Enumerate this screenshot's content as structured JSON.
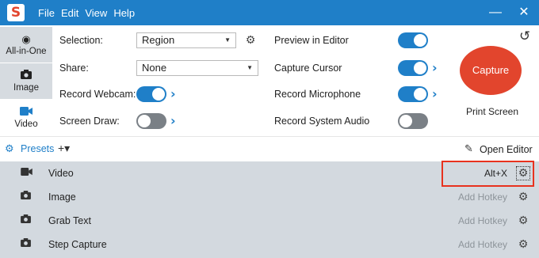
{
  "app": {
    "logo_letter": "S"
  },
  "menu": {
    "items": [
      "File",
      "Edit",
      "View",
      "Help"
    ]
  },
  "window": {
    "minimize": "—",
    "close": "✕"
  },
  "modes": [
    {
      "label": "All-in-One",
      "icon": "all-in-one-icon",
      "glyph": "◉",
      "active": false
    },
    {
      "label": "Image",
      "icon": "camera-icon",
      "glyph": "📷",
      "active": false
    },
    {
      "label": "Video",
      "icon": "video-camera-icon",
      "glyph": "■",
      "active": true
    }
  ],
  "settings": {
    "selection": {
      "label": "Selection:",
      "value": "Region"
    },
    "share": {
      "label": "Share:",
      "value": "None"
    },
    "record_webcam": {
      "label": "Record Webcam:",
      "on": true
    },
    "screen_draw": {
      "label": "Screen Draw:",
      "on": false
    },
    "preview_in_editor": {
      "label": "Preview in Editor",
      "on": true
    },
    "capture_cursor": {
      "label": "Capture Cursor",
      "on": true
    },
    "record_microphone": {
      "label": "Record Microphone",
      "on": true
    },
    "record_system_audio": {
      "label": "Record System Audio",
      "on": false
    }
  },
  "capture": {
    "button_label": "Capture",
    "hotkey": "Print Screen"
  },
  "presets": {
    "label": "Presets",
    "add": "+▾",
    "open_editor": "Open Editor",
    "items": [
      {
        "name": "Video",
        "icon": "video-camera-icon",
        "hotkey": "Alt+X",
        "assigned": true
      },
      {
        "name": "Image",
        "icon": "camera-icon",
        "hotkey": "Add Hotkey",
        "assigned": false
      },
      {
        "name": "Grab Text",
        "icon": "camera-icon",
        "hotkey": "Add Hotkey",
        "assigned": false
      },
      {
        "name": "Step Capture",
        "icon": "camera-icon",
        "hotkey": "Add Hotkey",
        "assigned": false
      }
    ]
  },
  "colors": {
    "accent": "#1f7fc8",
    "capture": "#e2452d",
    "highlight": "#e8321e",
    "toggle_off": "#7a8086"
  }
}
